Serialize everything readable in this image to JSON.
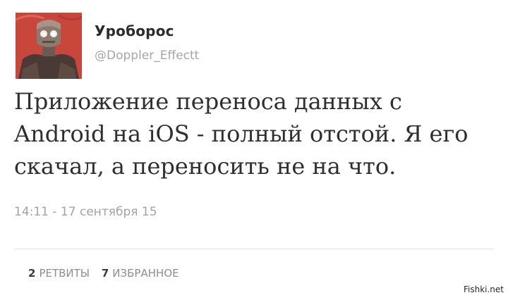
{
  "tweet": {
    "display_name": "Уроборос",
    "handle": "@Doppler_Effectt",
    "text": "Приложение переноса данных с Android на iOS - полный отстой. Я его скачал, а переносить не на что.",
    "timestamp": "14:11 - 17 сентября 15",
    "stats": {
      "retweets_count": "2",
      "retweets_label": "РЕТВИТЫ",
      "favorites_count": "7",
      "favorites_label": "ИЗБРАННОЕ"
    }
  },
  "avatar": {
    "icon": "robot-avatar-icon",
    "background_color": "#c9463a"
  },
  "watermark": "Fishki.net"
}
